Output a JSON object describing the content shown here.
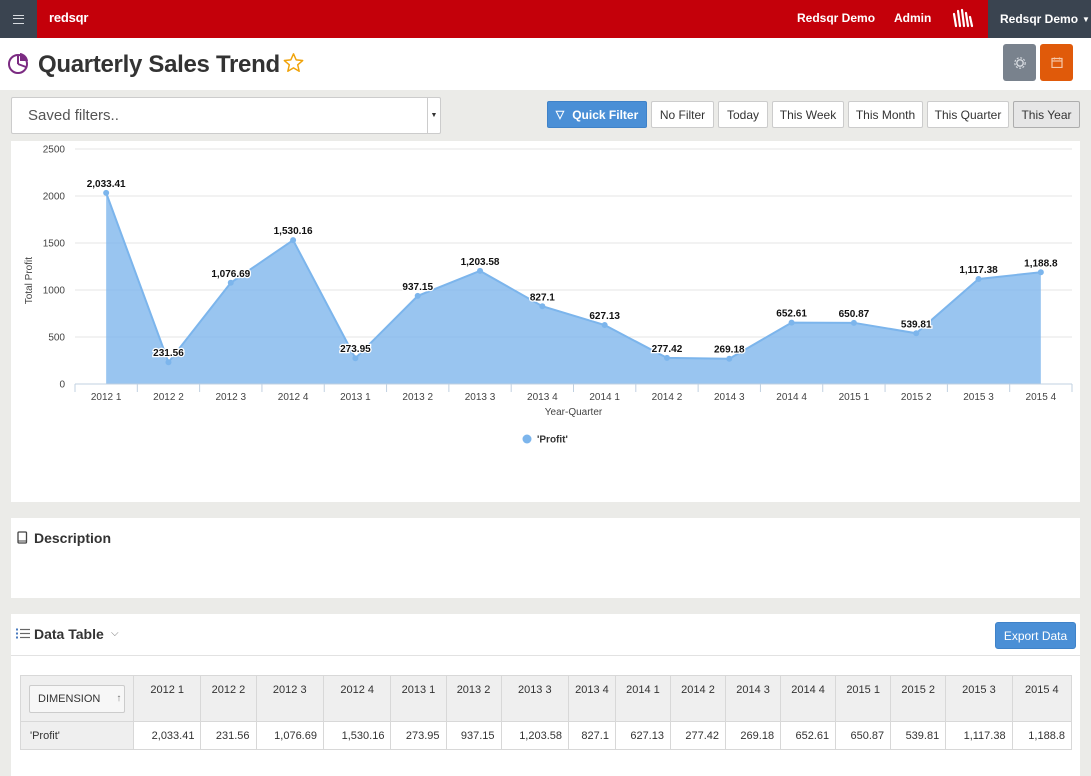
{
  "app": {
    "brand": "redsqr",
    "nav": {
      "account_label": "Redsqr Demo",
      "admin_label": "Admin",
      "user_menu_label": "Redsqr Demo"
    }
  },
  "header": {
    "title": "Quarterly Sales Trend"
  },
  "filters": {
    "saved_placeholder": "Saved filters..",
    "buttons": [
      "Quick Filter",
      "No Filter",
      "Today",
      "This Week",
      "This Month",
      "This Quarter",
      "This Year"
    ],
    "active": "This Year"
  },
  "chart_data": {
    "type": "area",
    "x": [
      "2012 1",
      "2012 2",
      "2012 3",
      "2012 4",
      "2013 1",
      "2013 2",
      "2013 3",
      "2013 4",
      "2014 1",
      "2014 2",
      "2014 3",
      "2014 4",
      "2015 1",
      "2015 2",
      "2015 3",
      "2015 4"
    ],
    "series": [
      {
        "name": "'Profit'",
        "values": [
          2033.41,
          231.56,
          1076.69,
          1530.16,
          273.95,
          937.15,
          1203.58,
          827.1,
          627.13,
          277.42,
          269.18,
          652.61,
          650.87,
          539.81,
          1117.38,
          1188.8
        ]
      }
    ],
    "data_labels": [
      "2,033.41",
      "231.56",
      "1,076.69",
      "1,530.16",
      "273.95",
      "937.15",
      "1,203.58",
      "827.1",
      "627.13",
      "277.42",
      "269.18",
      "652.61",
      "650.87",
      "539.81",
      "1,117.38",
      "1,188.8"
    ],
    "xlabel": "Year-Quarter",
    "ylabel": "Total Profit",
    "ylim": [
      0,
      2500
    ],
    "yticks": [
      0,
      500,
      1000,
      1500,
      2000,
      2500
    ],
    "grid": true,
    "legend": "bottom-center",
    "color": "#7cb5ec"
  },
  "description": {
    "title": "Description"
  },
  "data_table": {
    "title": "Data Table",
    "export_label": "Export Data",
    "dimension_label": "DIMENSION",
    "columns": [
      "2012 1",
      "2012 2",
      "2012 3",
      "2012 4",
      "2013 1",
      "2013 2",
      "2013 3",
      "2013 4",
      "2014 1",
      "2014 2",
      "2014 3",
      "2014 4",
      "2015 1",
      "2015 2",
      "2015 3",
      "2015 4"
    ],
    "rows": [
      {
        "label": "'Profit'",
        "values": [
          "2,033.41",
          "231.56",
          "1,076.69",
          "1,530.16",
          "273.95",
          "937.15",
          "1,203.58",
          "827.1",
          "627.13",
          "277.42",
          "269.18",
          "652.61",
          "650.87",
          "539.81",
          "1,117.38",
          "1,188.8"
        ]
      }
    ]
  }
}
